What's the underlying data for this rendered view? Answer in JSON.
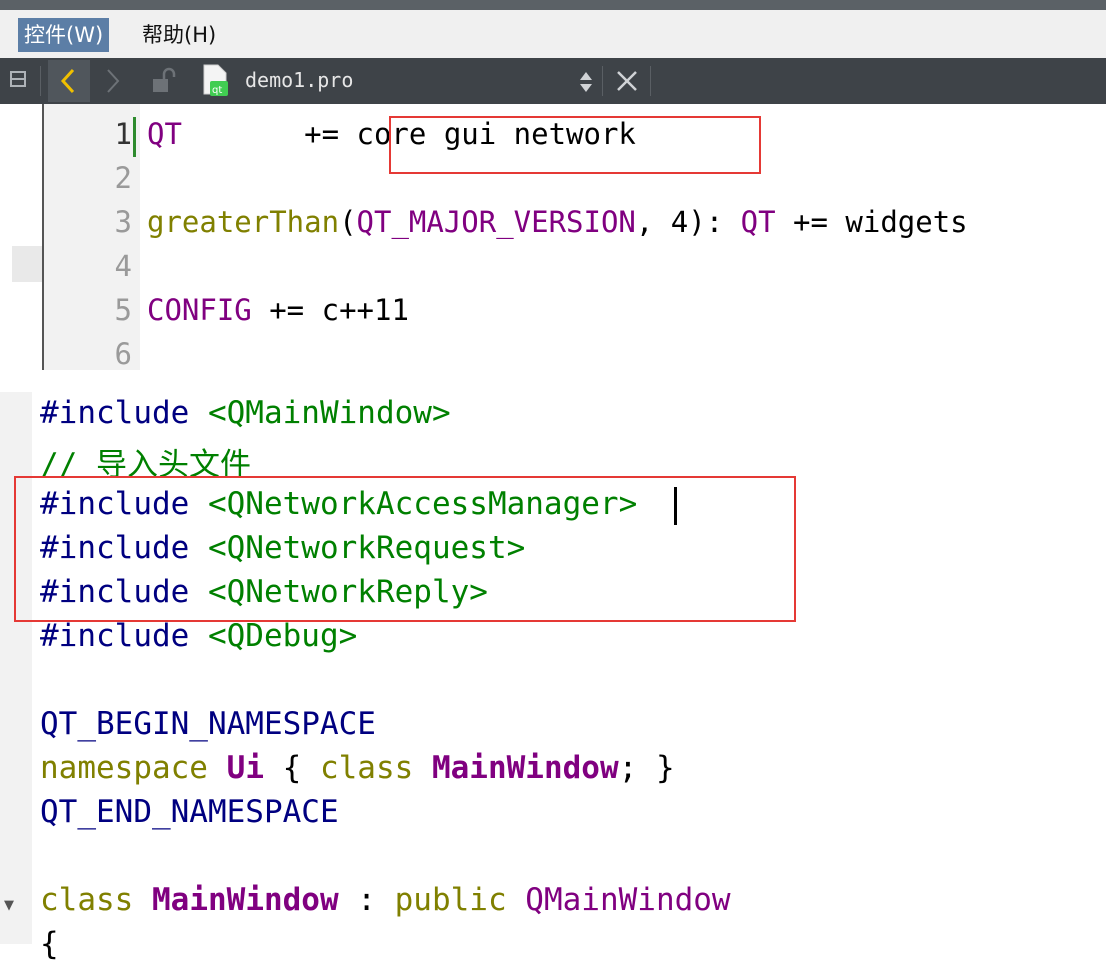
{
  "menubar": {
    "items": [
      {
        "label": "控件(W)",
        "active": true
      },
      {
        "label": "帮助(H)",
        "active": false
      }
    ]
  },
  "toolbar": {
    "file_name": "demo1.pro",
    "icons": [
      "split-icon",
      "back-icon",
      "forward-icon",
      "lock-icon",
      "qt-file-icon",
      "updown-icon",
      "close-icon"
    ]
  },
  "pro_file": {
    "line_numbers": [
      "1",
      "2",
      "3",
      "4",
      "5",
      "6"
    ],
    "lines": [
      {
        "t1": "QT",
        "t2": "       += core gui network"
      },
      {
        "t1": "",
        "t2": ""
      },
      {
        "t1": "greaterThan",
        "t2": "(",
        "t3": "QT_MAJOR_VERSION",
        "t4": ", 4): ",
        "t5": "QT",
        "t6": " += widgets"
      },
      {
        "t1": "",
        "t2": ""
      },
      {
        "t1": "CONFIG",
        "t2": " += c++11"
      },
      {
        "t1": "",
        "t2": ""
      }
    ]
  },
  "cpp_file": {
    "lines": [
      {
        "d": "#include ",
        "h": "<QMainWindow>"
      },
      {
        "c": "// 导入头文件"
      },
      {
        "d": "#include ",
        "h": "<QNetworkAccessManager>"
      },
      {
        "d": "#include ",
        "h": "<QNetworkRequest>"
      },
      {
        "d": "#include ",
        "h": "<QNetworkReply>"
      },
      {
        "d": "#include ",
        "h": "<QDebug>"
      },
      {
        "m": "QT_BEGIN_NAMESPACE"
      },
      {
        "k1": "namespace",
        "n1": " ",
        "n2": "Ui",
        "p1": " { ",
        "k2": "class",
        "n3": " ",
        "n4": "MainWindow",
        "p2": "; }"
      },
      {
        "m": "QT_END_NAMESPACE"
      },
      {
        "k1": "class",
        "n1": " ",
        "n2": "MainWindow",
        "p1": " : ",
        "k2": "public",
        "n3": " ",
        "n4": "QMainWindow"
      },
      {
        "p": "{"
      }
    ]
  },
  "colors": {
    "highlight_box": "#e53935",
    "keyword": "#808000",
    "type": "#800080",
    "macro": "#000080",
    "string": "#008000",
    "toolbar_bg": "#3e4348",
    "menu_active": "#5c7ea6"
  }
}
